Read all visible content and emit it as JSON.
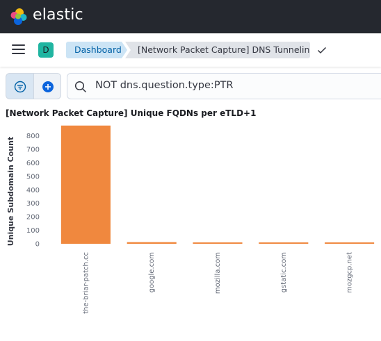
{
  "header": {
    "brand": "elastic",
    "colors": {
      "bg": "#25282f",
      "logo": [
        "#f0b913",
        "#ed4b82",
        "#21b5c8",
        "#0b64dd",
        "#93c83e"
      ]
    }
  },
  "nav": {
    "menu_icon": "hamburger-menu-icon",
    "space_initial": "D",
    "breadcrumbs": [
      "Dashboard",
      "[Network Packet Capture] DNS Tunneling"
    ],
    "check_icon": "check-icon"
  },
  "query": {
    "filter_icon": "filter-icon",
    "add_icon": "plus-circle-icon",
    "search_icon": "search-icon",
    "text": "NOT dns.question.type:PTR"
  },
  "panel": {
    "title": "[Network Packet Capture] Unique FQDNs per eTLD+1"
  },
  "chart_data": {
    "type": "bar",
    "title": "[Network Packet Capture] Unique FQDNs per eTLD+1",
    "xlabel": "",
    "ylabel": "Unique Subdomain Count",
    "categories": [
      "the-briar-patch.cc",
      "google.com",
      "mozilla.com",
      "gstatic.com",
      "mozgcp.net"
    ],
    "values": [
      876,
      12,
      10,
      10,
      10
    ],
    "ylim": [
      0,
      880
    ],
    "yticks": [
      0,
      100,
      200,
      300,
      400,
      500,
      600,
      700,
      800
    ],
    "bar_color": "#f0883e",
    "grid": false
  }
}
